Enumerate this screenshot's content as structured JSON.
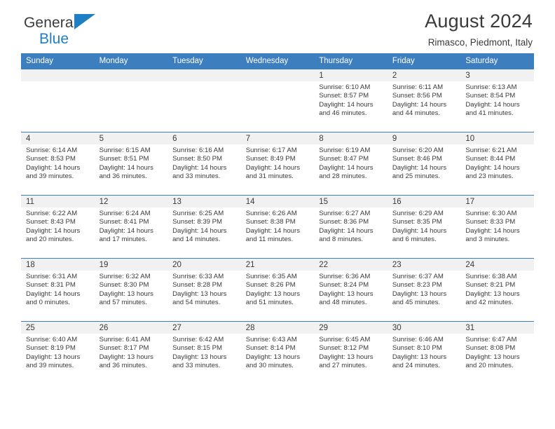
{
  "brand": {
    "name_top": "General",
    "name_bottom": "Blue",
    "flag_icon": "triangle-flag-icon",
    "accent_color": "#1f7fc4"
  },
  "header": {
    "title": "August 2024",
    "subtitle": "Rimasco, Piedmont, Italy"
  },
  "theme": {
    "header_bg": "#3d7ebf",
    "daynum_band_bg": "#f1f1f1",
    "text_color": "#3a3a3a"
  },
  "weekday_headers": [
    "Sunday",
    "Monday",
    "Tuesday",
    "Wednesday",
    "Thursday",
    "Friday",
    "Saturday"
  ],
  "labels": {
    "sunrise": "Sunrise:",
    "sunset": "Sunset:",
    "daylight": "Daylight:"
  },
  "weeks": [
    [
      {
        "day": "",
        "empty": true
      },
      {
        "day": "",
        "empty": true
      },
      {
        "day": "",
        "empty": true
      },
      {
        "day": "",
        "empty": true
      },
      {
        "day": "1",
        "sunrise": "Sunrise: 6:10 AM",
        "sunset": "Sunset: 8:57 PM",
        "daylight_1": "Daylight: 14 hours",
        "daylight_2": "and 46 minutes."
      },
      {
        "day": "2",
        "sunrise": "Sunrise: 6:11 AM",
        "sunset": "Sunset: 8:56 PM",
        "daylight_1": "Daylight: 14 hours",
        "daylight_2": "and 44 minutes."
      },
      {
        "day": "3",
        "sunrise": "Sunrise: 6:13 AM",
        "sunset": "Sunset: 8:54 PM",
        "daylight_1": "Daylight: 14 hours",
        "daylight_2": "and 41 minutes."
      }
    ],
    [
      {
        "day": "4",
        "sunrise": "Sunrise: 6:14 AM",
        "sunset": "Sunset: 8:53 PM",
        "daylight_1": "Daylight: 14 hours",
        "daylight_2": "and 39 minutes."
      },
      {
        "day": "5",
        "sunrise": "Sunrise: 6:15 AM",
        "sunset": "Sunset: 8:51 PM",
        "daylight_1": "Daylight: 14 hours",
        "daylight_2": "and 36 minutes."
      },
      {
        "day": "6",
        "sunrise": "Sunrise: 6:16 AM",
        "sunset": "Sunset: 8:50 PM",
        "daylight_1": "Daylight: 14 hours",
        "daylight_2": "and 33 minutes."
      },
      {
        "day": "7",
        "sunrise": "Sunrise: 6:17 AM",
        "sunset": "Sunset: 8:49 PM",
        "daylight_1": "Daylight: 14 hours",
        "daylight_2": "and 31 minutes."
      },
      {
        "day": "8",
        "sunrise": "Sunrise: 6:19 AM",
        "sunset": "Sunset: 8:47 PM",
        "daylight_1": "Daylight: 14 hours",
        "daylight_2": "and 28 minutes."
      },
      {
        "day": "9",
        "sunrise": "Sunrise: 6:20 AM",
        "sunset": "Sunset: 8:46 PM",
        "daylight_1": "Daylight: 14 hours",
        "daylight_2": "and 25 minutes."
      },
      {
        "day": "10",
        "sunrise": "Sunrise: 6:21 AM",
        "sunset": "Sunset: 8:44 PM",
        "daylight_1": "Daylight: 14 hours",
        "daylight_2": "and 23 minutes."
      }
    ],
    [
      {
        "day": "11",
        "sunrise": "Sunrise: 6:22 AM",
        "sunset": "Sunset: 8:43 PM",
        "daylight_1": "Daylight: 14 hours",
        "daylight_2": "and 20 minutes."
      },
      {
        "day": "12",
        "sunrise": "Sunrise: 6:24 AM",
        "sunset": "Sunset: 8:41 PM",
        "daylight_1": "Daylight: 14 hours",
        "daylight_2": "and 17 minutes."
      },
      {
        "day": "13",
        "sunrise": "Sunrise: 6:25 AM",
        "sunset": "Sunset: 8:39 PM",
        "daylight_1": "Daylight: 14 hours",
        "daylight_2": "and 14 minutes."
      },
      {
        "day": "14",
        "sunrise": "Sunrise: 6:26 AM",
        "sunset": "Sunset: 8:38 PM",
        "daylight_1": "Daylight: 14 hours",
        "daylight_2": "and 11 minutes."
      },
      {
        "day": "15",
        "sunrise": "Sunrise: 6:27 AM",
        "sunset": "Sunset: 8:36 PM",
        "daylight_1": "Daylight: 14 hours",
        "daylight_2": "and 8 minutes."
      },
      {
        "day": "16",
        "sunrise": "Sunrise: 6:29 AM",
        "sunset": "Sunset: 8:35 PM",
        "daylight_1": "Daylight: 14 hours",
        "daylight_2": "and 6 minutes."
      },
      {
        "day": "17",
        "sunrise": "Sunrise: 6:30 AM",
        "sunset": "Sunset: 8:33 PM",
        "daylight_1": "Daylight: 14 hours",
        "daylight_2": "and 3 minutes."
      }
    ],
    [
      {
        "day": "18",
        "sunrise": "Sunrise: 6:31 AM",
        "sunset": "Sunset: 8:31 PM",
        "daylight_1": "Daylight: 14 hours",
        "daylight_2": "and 0 minutes."
      },
      {
        "day": "19",
        "sunrise": "Sunrise: 6:32 AM",
        "sunset": "Sunset: 8:30 PM",
        "daylight_1": "Daylight: 13 hours",
        "daylight_2": "and 57 minutes."
      },
      {
        "day": "20",
        "sunrise": "Sunrise: 6:33 AM",
        "sunset": "Sunset: 8:28 PM",
        "daylight_1": "Daylight: 13 hours",
        "daylight_2": "and 54 minutes."
      },
      {
        "day": "21",
        "sunrise": "Sunrise: 6:35 AM",
        "sunset": "Sunset: 8:26 PM",
        "daylight_1": "Daylight: 13 hours",
        "daylight_2": "and 51 minutes."
      },
      {
        "day": "22",
        "sunrise": "Sunrise: 6:36 AM",
        "sunset": "Sunset: 8:24 PM",
        "daylight_1": "Daylight: 13 hours",
        "daylight_2": "and 48 minutes."
      },
      {
        "day": "23",
        "sunrise": "Sunrise: 6:37 AM",
        "sunset": "Sunset: 8:23 PM",
        "daylight_1": "Daylight: 13 hours",
        "daylight_2": "and 45 minutes."
      },
      {
        "day": "24",
        "sunrise": "Sunrise: 6:38 AM",
        "sunset": "Sunset: 8:21 PM",
        "daylight_1": "Daylight: 13 hours",
        "daylight_2": "and 42 minutes."
      }
    ],
    [
      {
        "day": "25",
        "sunrise": "Sunrise: 6:40 AM",
        "sunset": "Sunset: 8:19 PM",
        "daylight_1": "Daylight: 13 hours",
        "daylight_2": "and 39 minutes."
      },
      {
        "day": "26",
        "sunrise": "Sunrise: 6:41 AM",
        "sunset": "Sunset: 8:17 PM",
        "daylight_1": "Daylight: 13 hours",
        "daylight_2": "and 36 minutes."
      },
      {
        "day": "27",
        "sunrise": "Sunrise: 6:42 AM",
        "sunset": "Sunset: 8:15 PM",
        "daylight_1": "Daylight: 13 hours",
        "daylight_2": "and 33 minutes."
      },
      {
        "day": "28",
        "sunrise": "Sunrise: 6:43 AM",
        "sunset": "Sunset: 8:14 PM",
        "daylight_1": "Daylight: 13 hours",
        "daylight_2": "and 30 minutes."
      },
      {
        "day": "29",
        "sunrise": "Sunrise: 6:45 AM",
        "sunset": "Sunset: 8:12 PM",
        "daylight_1": "Daylight: 13 hours",
        "daylight_2": "and 27 minutes."
      },
      {
        "day": "30",
        "sunrise": "Sunrise: 6:46 AM",
        "sunset": "Sunset: 8:10 PM",
        "daylight_1": "Daylight: 13 hours",
        "daylight_2": "and 24 minutes."
      },
      {
        "day": "31",
        "sunrise": "Sunrise: 6:47 AM",
        "sunset": "Sunset: 8:08 PM",
        "daylight_1": "Daylight: 13 hours",
        "daylight_2": "and 20 minutes."
      }
    ]
  ]
}
